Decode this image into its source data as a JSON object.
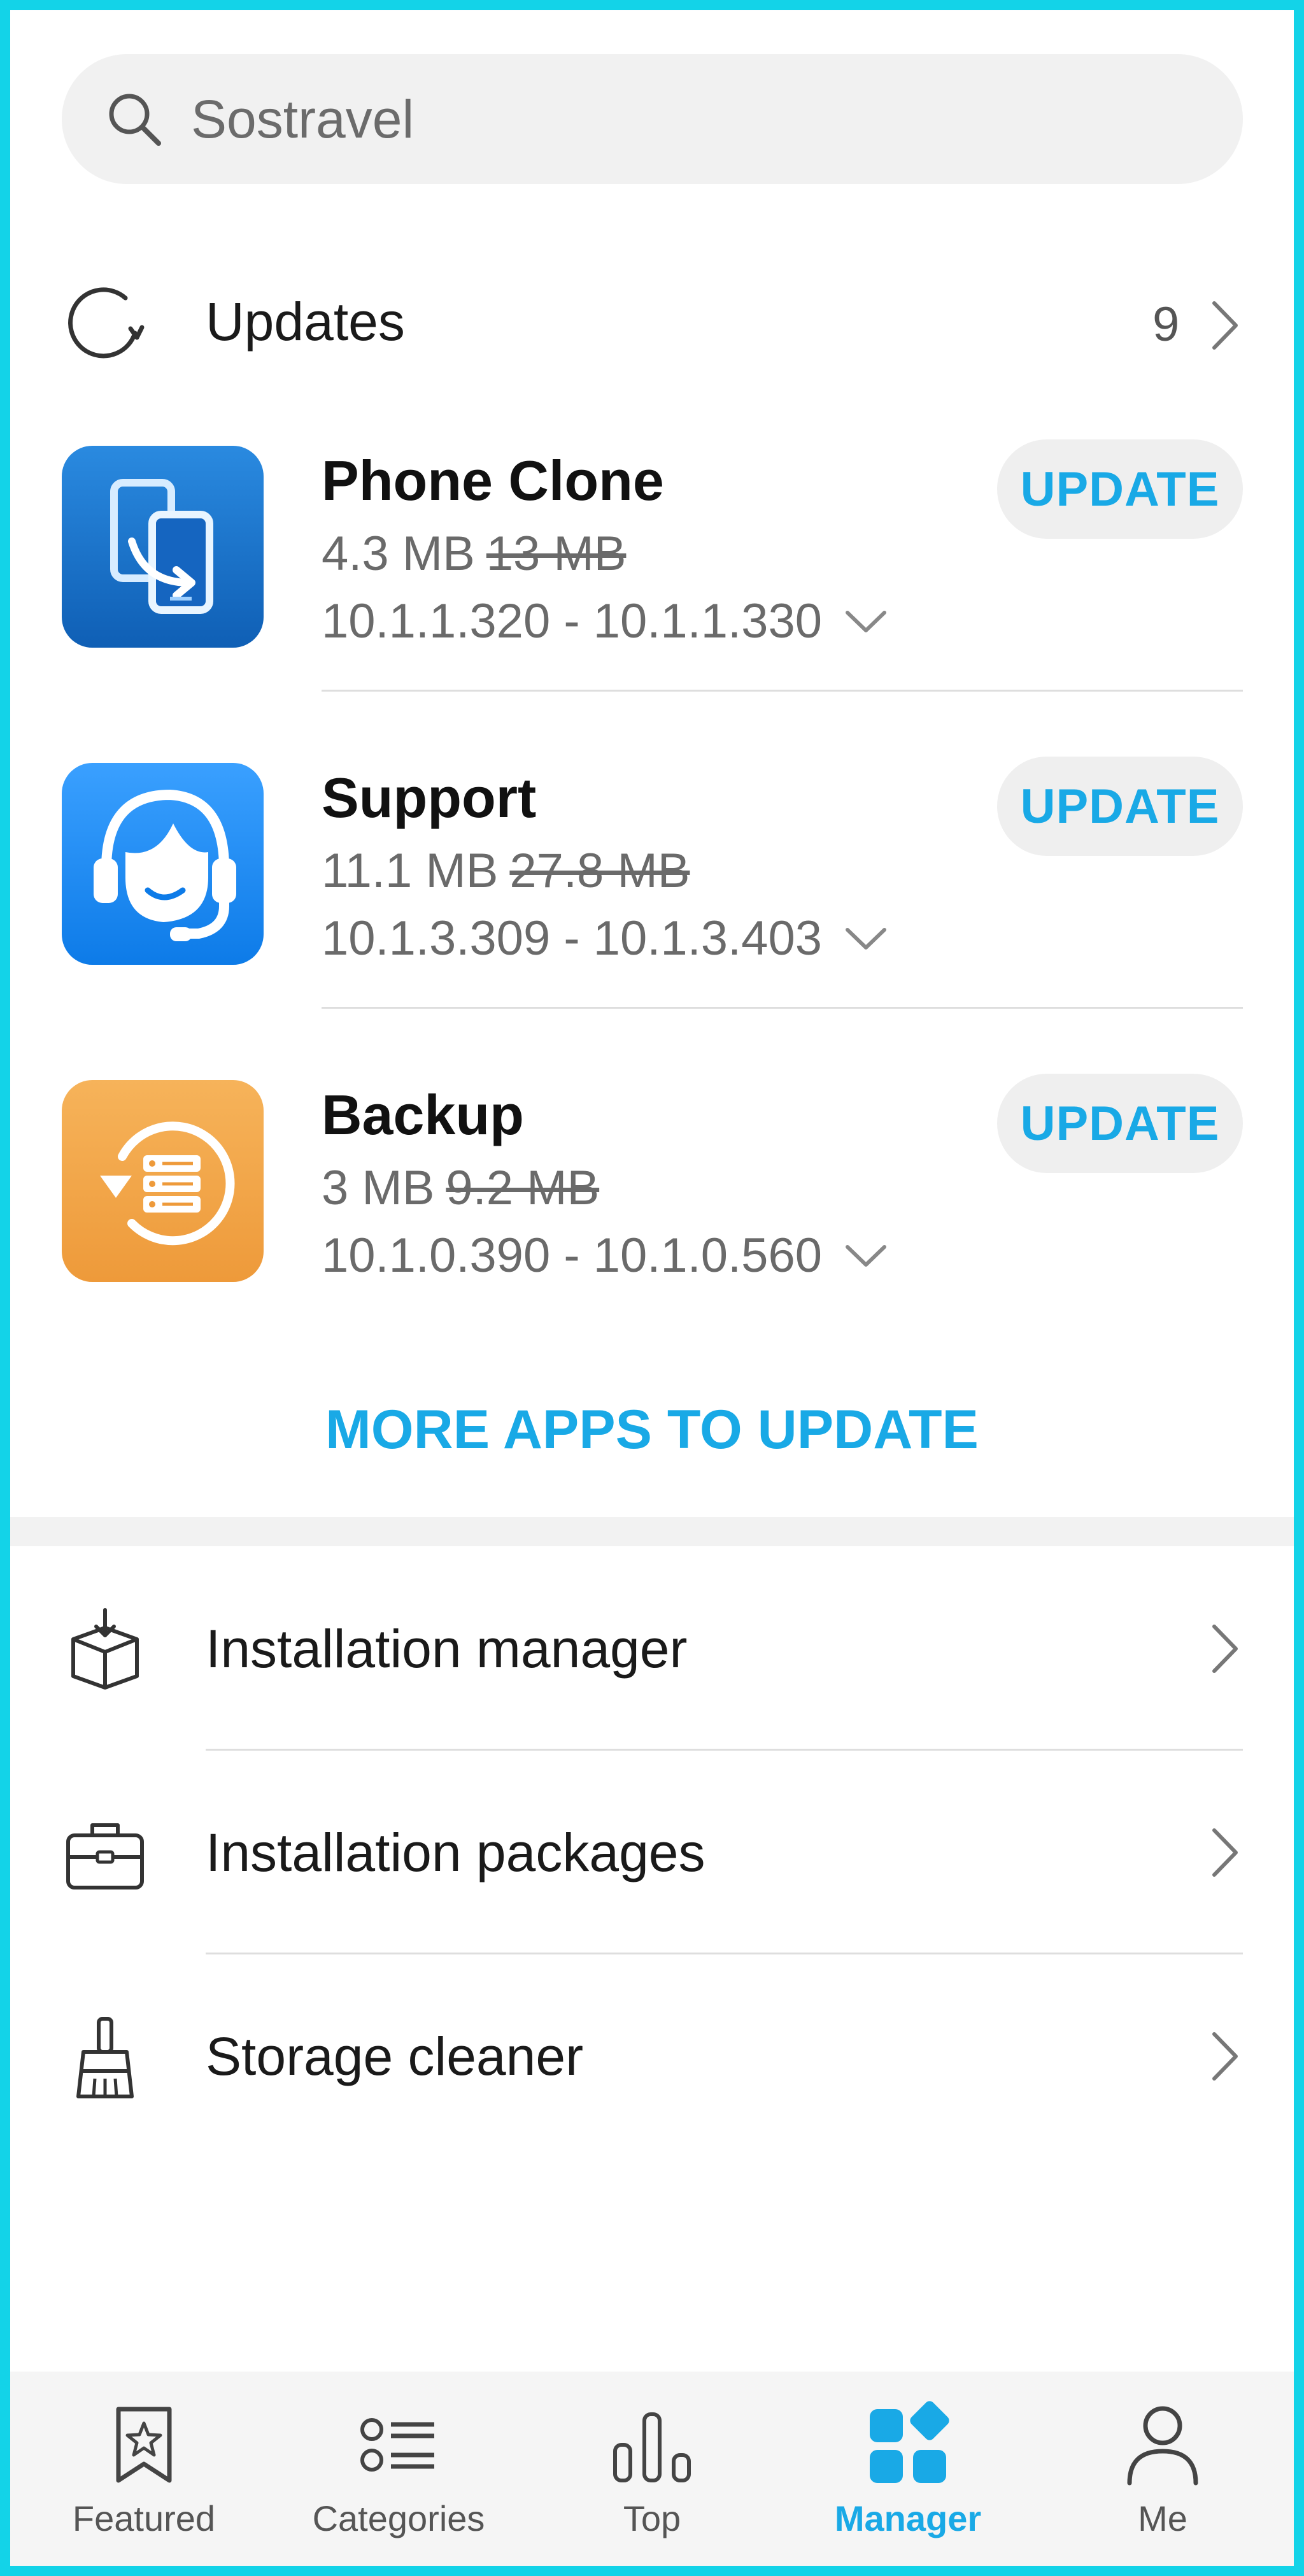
{
  "search": {
    "placeholder": "Sostravel"
  },
  "updates": {
    "label": "Updates",
    "count": "9"
  },
  "apps": [
    {
      "name": "Phone Clone",
      "new_size": "4.3 MB",
      "old_size": "13 MB",
      "versions": "10.1.1.320 - 10.1.1.330",
      "button": "UPDATE",
      "icon_color": "#1a6fc2"
    },
    {
      "name": "Support",
      "new_size": "11.1 MB",
      "old_size": "27.8 MB",
      "versions": "10.1.3.309 - 10.1.3.403",
      "button": "UPDATE",
      "icon_color": "#1e88f0"
    },
    {
      "name": "Backup",
      "new_size": "3 MB",
      "old_size": "9.2 MB",
      "versions": "10.1.0.390 - 10.1.0.560",
      "button": "UPDATE",
      "icon_color": "#f0a045"
    }
  ],
  "more_apps": "MORE APPS TO UPDATE",
  "menu": [
    {
      "label": "Installation manager",
      "icon": "box-download-icon"
    },
    {
      "label": "Installation packages",
      "icon": "briefcase-icon"
    },
    {
      "label": "Storage cleaner",
      "icon": "broom-icon"
    }
  ],
  "nav": [
    {
      "label": "Featured",
      "icon": "bookmark-star-icon",
      "active": false
    },
    {
      "label": "Categories",
      "icon": "list-icon",
      "active": false
    },
    {
      "label": "Top",
      "icon": "bar-chart-icon",
      "active": false
    },
    {
      "label": "Manager",
      "icon": "grid-icon",
      "active": true
    },
    {
      "label": "Me",
      "icon": "person-icon",
      "active": false
    }
  ],
  "colors": {
    "accent": "#19a9e6",
    "frame": "#13d3e8"
  }
}
